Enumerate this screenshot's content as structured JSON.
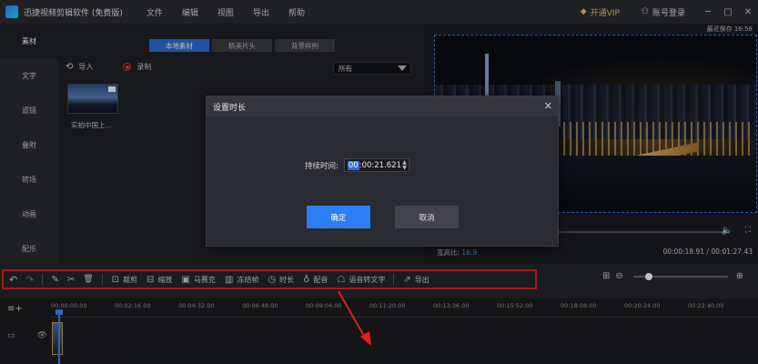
{
  "titlebar": {
    "app_title": "迅捷视频剪辑软件 (免费版)",
    "menu": [
      "文件",
      "编辑",
      "视图",
      "导出",
      "帮助"
    ],
    "vip": "开通VIP",
    "account": "账号登录",
    "window_buttons": [
      "─",
      "□",
      "✕"
    ]
  },
  "sidebar": {
    "items": [
      {
        "label": "素材"
      },
      {
        "label": "文字"
      },
      {
        "label": "滤镜"
      },
      {
        "label": "叠附"
      },
      {
        "label": "转场"
      },
      {
        "label": "动画"
      },
      {
        "label": "配乐"
      }
    ]
  },
  "material": {
    "tabs": [
      "本地素材",
      "精美片头",
      "背景样例"
    ],
    "import_label": "导入",
    "record_label": "录制",
    "filter_value": "所有",
    "thumb_label": "实拍中国上..."
  },
  "preview": {
    "autosave": "最近保存 16:58",
    "ratio_label": "宽高比:",
    "ratio_value": "16:9",
    "timecode": "00:00:18.91 / 00:01:27.43",
    "volume_icon": "🔈",
    "fullscreen_icon": "⛶"
  },
  "dialog": {
    "title": "设置时长",
    "close": "✕",
    "duration_label": "持续时间:",
    "duration_hl": "00",
    "duration_rest": ":00:21.621",
    "ok": "确定",
    "cancel": "取消"
  },
  "toolbar": {
    "undo_icon": "↶",
    "redo_icon": "↷",
    "edit_icon": "✎",
    "cut_icon": "✂",
    "delete_icon": "🗑",
    "tools": [
      {
        "icon": "⊡",
        "label": "裁剪"
      },
      {
        "icon": "⊟",
        "label": "缩放"
      },
      {
        "icon": "▣",
        "label": "马赛克"
      },
      {
        "icon": "▥",
        "label": "冻结帧"
      },
      {
        "icon": "◷",
        "label": "时长"
      },
      {
        "icon": "♁",
        "label": "配音"
      },
      {
        "icon": "☖",
        "label": "语音转文字"
      },
      {
        "icon": "⇗",
        "label": "导出"
      }
    ],
    "zoom_out_icon": "⊖",
    "zoom_in_icon": "⊕",
    "fit_icon": "⊞",
    "zoom_level": 0.14
  },
  "timeline": {
    "add_icon": "≡+",
    "ticks": [
      "00:00:00.00",
      "00:02:16.00",
      "00:04:32.00",
      "00:06:48.00",
      "00:09:04.00",
      "00:11:20.00",
      "00:13:36.00",
      "00:15:52.00",
      "00:18:08.00",
      "00:20:24.00",
      "00:22:40.00"
    ]
  }
}
